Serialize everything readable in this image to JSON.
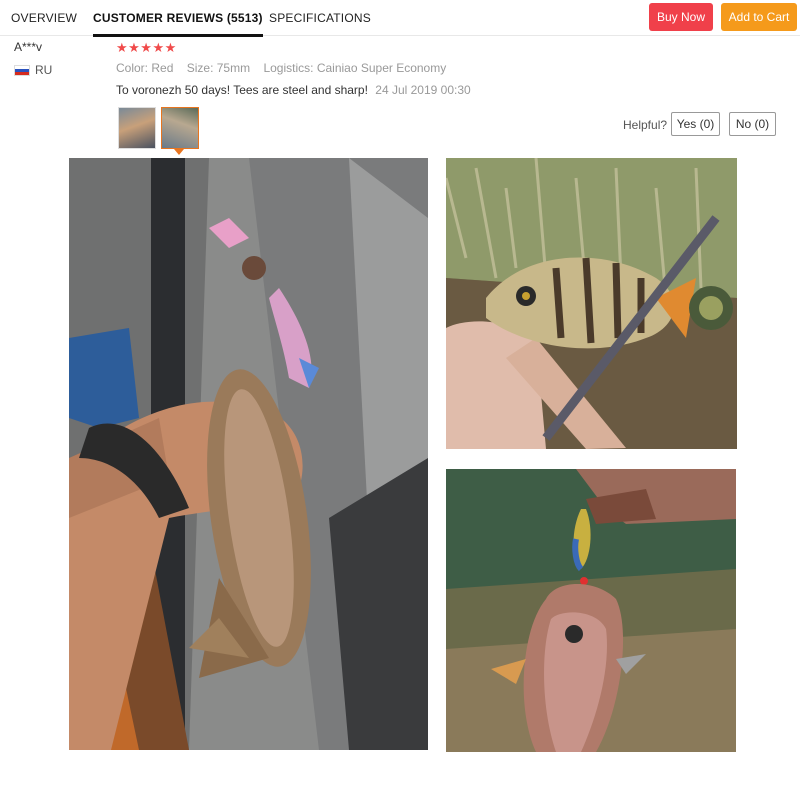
{
  "tabs": {
    "overview": "OVERVIEW",
    "reviews": "CUSTOMER REVIEWS (5513)",
    "specifications": "SPECIFICATIONS"
  },
  "actions": {
    "buy_now": "Buy Now",
    "add_to_cart": "Add to Cart"
  },
  "colors": {
    "buy_now": "#f0404a",
    "add_to_cart": "#f59a1b",
    "stars": "#f04a4a",
    "selected_thumb": "#e8751f"
  },
  "review": {
    "reviewer": "A***v",
    "country": "RU",
    "stars": "★★★★★",
    "rating": 5,
    "color_label": "Color:",
    "color_value": "Red",
    "size_label": "Size:",
    "size_value": "75mm",
    "logistics_label": "Logistics:",
    "logistics_value": "Cainiao Super Economy",
    "text": "To voronezh 50 days! Tees are steel and sharp!",
    "date": "24 Jul 2019 00:30"
  },
  "feedback": {
    "label": "Helpful?",
    "yes": "Yes (0)",
    "no": "No (0)"
  }
}
